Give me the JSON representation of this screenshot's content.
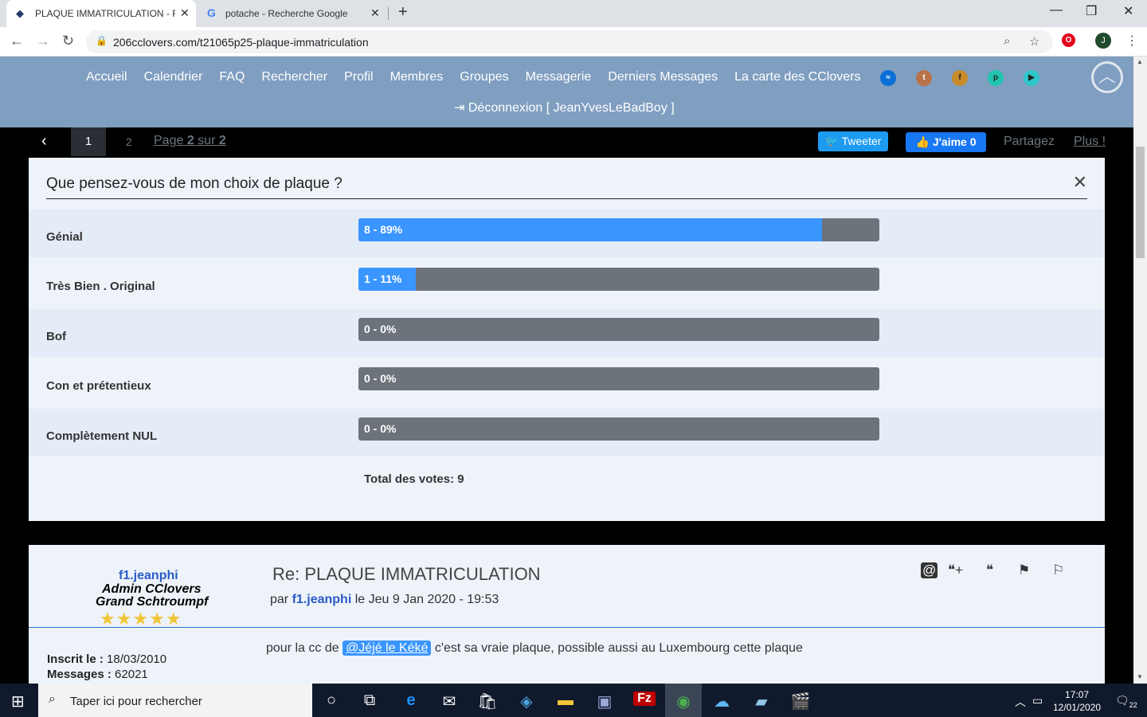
{
  "browser": {
    "tabs": [
      {
        "title": "PLAQUE IMMATRICULATION - Pa",
        "active": true
      },
      {
        "title": "potache - Recherche Google",
        "active": false
      }
    ],
    "url": "206cclovers.com/t21065p25-plaque-immatriculation",
    "profile_initial": "J",
    "new_tab": "+"
  },
  "site": {
    "nav": [
      "Accueil",
      "Calendrier",
      "FAQ",
      "Rechercher",
      "Profil",
      "Membres",
      "Groupes",
      "Messagerie",
      "Derniers Messages",
      "La carte des CClovers"
    ],
    "logout": "Déconnexion [ JeanYvesLeBadBoy ]"
  },
  "pagination": {
    "current": "1",
    "other": "2",
    "label_prefix": "Page ",
    "label_page": "2",
    "label_mid": " sur ",
    "label_total": "2",
    "tweet": "Tweeter",
    "like": "J'aime 0",
    "share": "Partagez",
    "more": "Plus !"
  },
  "poll": {
    "question": "Que pensez-vous de mon choix de plaque ?",
    "options": [
      {
        "label": "Génial",
        "value": "8 - 89%",
        "fraction": 0.89
      },
      {
        "label": "Très Bien . Original",
        "value": "1 - 11%",
        "fraction": 0.11
      },
      {
        "label": "Bof",
        "value": "0 - 0%",
        "fraction": 0
      },
      {
        "label": "Con et prétentieux",
        "value": "0 - 0%",
        "fraction": 0
      },
      {
        "label": "Complètement NUL",
        "value": "0 - 0%",
        "fraction": 0
      }
    ],
    "total": "Total des votes: 9"
  },
  "post": {
    "author": "f1.jeanphi",
    "rank1": "Admin CClovers",
    "rank2": "Grand Schtroumpf",
    "stars": "★★★★★",
    "title": "Re: PLAQUE IMMATRICULATION",
    "meta_prefix": "par ",
    "meta_author": "f1.jeanphi",
    "meta_date": " le Jeu 9 Jan 2020 - 19:53",
    "inscrit_label": "Inscrit le : ",
    "inscrit_value": "18/03/2010",
    "messages_label": "Messages : ",
    "messages_value": "62021",
    "body_prefix": "pour la cc de ",
    "body_mention": "@Jéjé le Kéké",
    "body_suffix": " c'est sa vraie plaque, possible aussi au Luxembourg cette plaque"
  },
  "taskbar": {
    "search_placeholder": "Taper ici pour rechercher",
    "time": "17:07",
    "date": "12/01/2020",
    "notifications": "22"
  }
}
